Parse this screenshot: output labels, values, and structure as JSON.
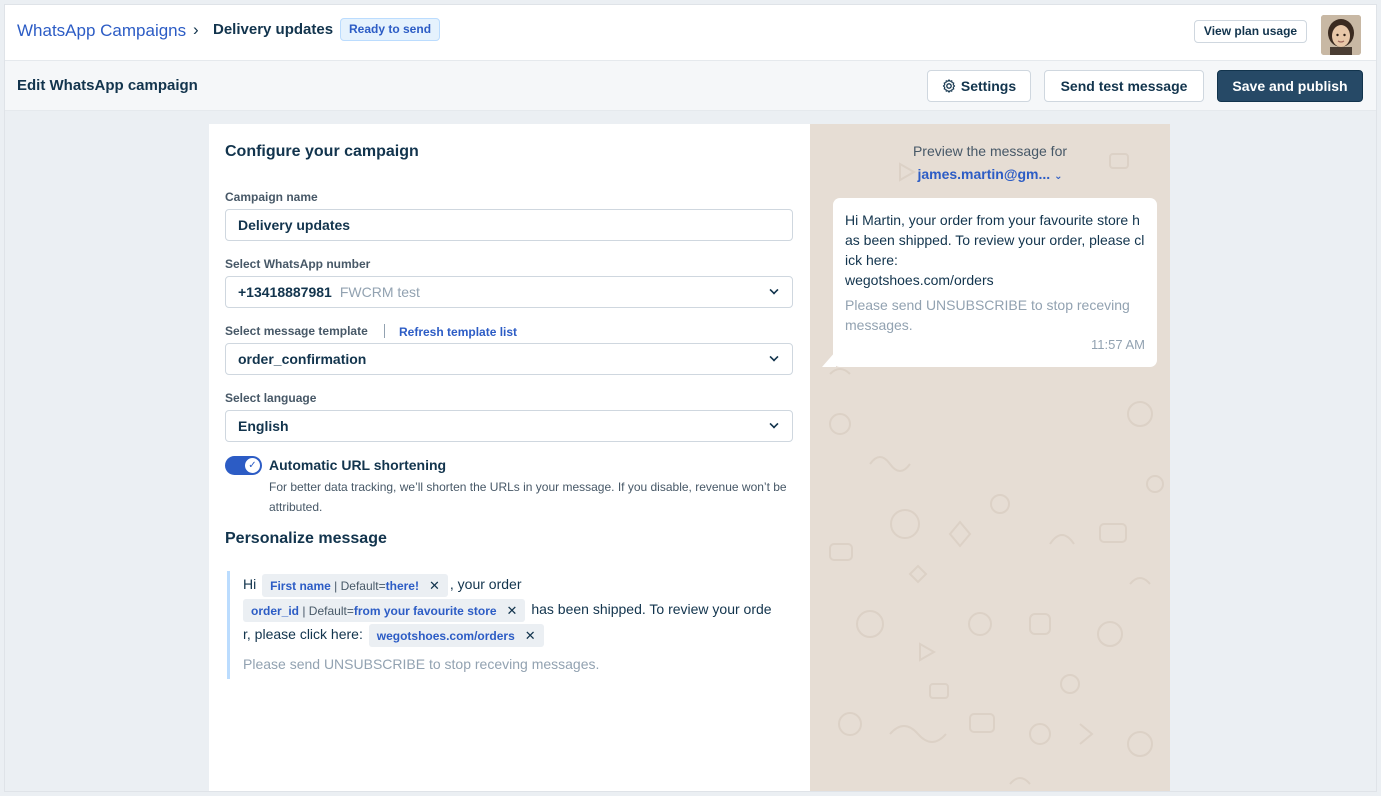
{
  "header": {
    "breadcrumb_link": "WhatsApp Campaigns",
    "breadcrumb_sep": "›",
    "breadcrumb_current": "Delivery updates",
    "status": "Ready to send",
    "plan_button": "View plan usage"
  },
  "toolbar": {
    "title": "Edit WhatsApp campaign",
    "settings_label": "Settings",
    "test_label": "Send test message",
    "publish_label": "Save and publish"
  },
  "form": {
    "section_title": "Configure your campaign",
    "campaign_name_label": "Campaign name",
    "campaign_name_value": "Delivery updates",
    "number_label": "Select WhatsApp number",
    "number_value": "+13418887981",
    "number_account": "FWCRM test",
    "template_label": "Select message template",
    "refresh_label": "Refresh template list",
    "template_value": "order_confirmation",
    "language_label": "Select language",
    "language_value": "English",
    "url_shortening_title": "Automatic URL shortening",
    "url_shortening_desc": "For better data tracking, we’ll shorten the URLs in your message. If you disable, revenue won’t be attributed.",
    "url_shortening_on": true
  },
  "personalize": {
    "title": "Personalize message",
    "text_hi": "Hi",
    "chip1_name": "First name",
    "chip1_default_prefix": " | Default=",
    "chip1_default": "there!",
    "text_your_order": ", your order",
    "chip2_name": "order_id",
    "chip2_default_prefix": " | Default=",
    "chip2_default": "from your favourite store",
    "text_shipped": " has been shipped. To review your orde",
    "text_click": "r, please click here:",
    "chip3_name": "wegotshoes.com/orders",
    "remove_glyph": "✕",
    "unsubscribe_hint": "Please send UNSUBSCRIBE to stop receving messages."
  },
  "preview": {
    "label": "Preview the message for",
    "user": "james.martin@gm...",
    "body": "Hi Martin, your order from your favourite store has been shipped. To review your order, please click here:",
    "link": "wegotshoes.com/orders",
    "footer": "Please send UNSUBSCRIBE to stop receving messages.",
    "time": "11:57 AM"
  },
  "colors": {
    "brand_blue": "#2c5cc5",
    "primary_button": "#264966",
    "preview_bg": "#e6ddd4"
  }
}
